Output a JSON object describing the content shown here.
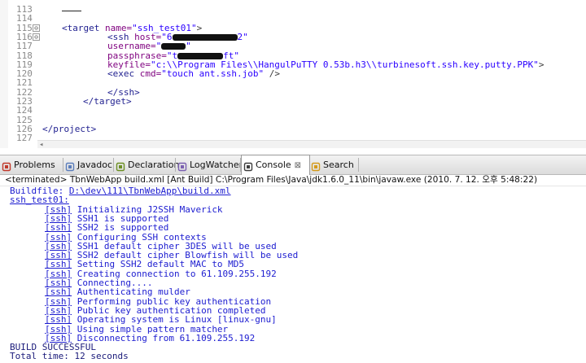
{
  "editor": {
    "lines": [
      {
        "num": "113",
        "text": ""
      },
      {
        "num": "114",
        "text": ""
      },
      {
        "num": "115",
        "fold": "⊖",
        "tag": "<target",
        "attr": " name=",
        "val": "\"ssh_test01\"",
        "end": ">"
      },
      {
        "num": "116",
        "fold": "⊖",
        "tag": "<ssh",
        "attr": " host=",
        "val": "\"6",
        "redact": 80,
        "val2": "2\""
      },
      {
        "num": "117",
        "text2": "username=",
        "val": "\"",
        "redact": 30,
        "val2": "\""
      },
      {
        "num": "118",
        "text2": "passphrase=",
        "val": "\"t",
        "redact": 56,
        "val2": "ft\""
      },
      {
        "num": "119",
        "text2": "keyfile=",
        "val": "\"c:\\\\Program Files\\\\HangulPuTTY 0.53b.h3\\\\turbinesoft.ssh.key.putty.PPK\"",
        "end": ">"
      },
      {
        "num": "120",
        "tag": "<exec",
        "attr": " cmd=",
        "val": "\"touch ant.ssh.job\"",
        "end": " />"
      },
      {
        "num": "121",
        "text": ""
      },
      {
        "num": "122",
        "tag": "</ssh>"
      },
      {
        "num": "123",
        "tag": "</target>"
      },
      {
        "num": "124",
        "text": ""
      },
      {
        "num": "125",
        "text": ""
      },
      {
        "num": "126",
        "tag": "</project>"
      },
      {
        "num": "127",
        "text": ""
      }
    ]
  },
  "tabs": [
    {
      "label": "Problems",
      "icon": "problems-icon"
    },
    {
      "label": "Javadoc",
      "icon": "javadoc-icon"
    },
    {
      "label": "Declaration",
      "icon": "declaration-icon"
    },
    {
      "label": "LogWatcher",
      "icon": "logwatcher-icon"
    },
    {
      "label": "Console",
      "icon": "console-icon",
      "close": "⊠"
    },
    {
      "label": "Search",
      "icon": "search-icon"
    }
  ],
  "console": {
    "status": "<terminated> TbnWebApp build.xml [Ant Build] C:\\Program Files\\Java\\jdk1.6.0_11\\bin\\javaw.exe (2010. 7. 12. 오후 5:48:22)",
    "buildfile_label": "Buildfile: ",
    "buildfile_path": "D:\\dev\\111\\TbnWebApp\\build.xml",
    "target": "ssh_test01:",
    "ssh_tag": "[ssh]",
    "messages": [
      "Initializing J2SSH Maverick",
      "SSH1 is supported",
      "SSH2 is supported",
      "Configuring SSH contexts",
      "SSH1 default cipher 3DES will be used",
      "SSH2 default cipher Blowfish will be used",
      "Setting SSH2 default MAC to MD5",
      "Creating connection to 61.109.255.192",
      "Connecting....",
      "Authenticating mulder",
      "Performing public key authentication",
      "Public key authentication completed",
      "Operating system is Linux [linux-gnu]",
      "Using simple pattern matcher",
      "Disconnecting from 61.109.255.192"
    ],
    "result": "BUILD SUCCESSFUL",
    "total_time": "Total time: 12 seconds"
  }
}
